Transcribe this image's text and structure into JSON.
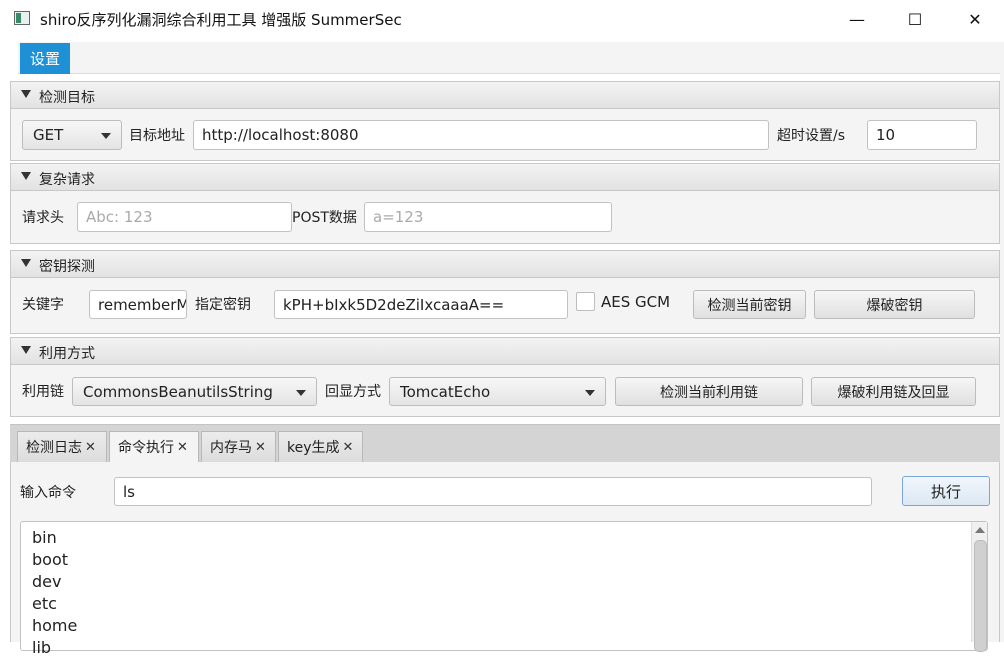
{
  "window": {
    "title": "shiro反序列化漏洞综合利用工具 增强版 SummerSec",
    "minimize": "—",
    "maximize": "☐",
    "close": "✕"
  },
  "menu": {
    "settings": "设置"
  },
  "target": {
    "header": "检测目标",
    "method": "GET",
    "url_label": "目标地址",
    "url_value": "http://localhost:8080",
    "timeout_label": "超时设置/s",
    "timeout_value": "10"
  },
  "complex": {
    "header": "复杂请求",
    "headers_label": "请求头",
    "headers_placeholder": "Abc: 123",
    "post_label": "POST数据",
    "post_placeholder": "a=123"
  },
  "key": {
    "header": "密钥探测",
    "keyword_label": "关键字",
    "keyword_value": "rememberMe",
    "specify_label": "指定密钥",
    "key_value": "kPH+bIxk5D2deZiIxcaaaA==",
    "aes_gcm_label": "AES GCM",
    "check_button": "检测当前密钥",
    "brute_button": "爆破密钥"
  },
  "exploit": {
    "header": "利用方式",
    "chain_label": "利用链",
    "chain_value": "CommonsBeanutilsString",
    "echo_label": "回显方式",
    "echo_value": "TomcatEcho",
    "check_button": "检测当前利用链",
    "brute_button": "爆破利用链及回显"
  },
  "tabs": [
    {
      "label": "检测日志",
      "close": "✕"
    },
    {
      "label": "命令执行",
      "close": "✕"
    },
    {
      "label": "内存马",
      "close": "✕"
    },
    {
      "label": "key生成",
      "close": "✕"
    }
  ],
  "command": {
    "input_label": "输入命令",
    "input_value": "ls",
    "execute_button": "执行",
    "output_lines": [
      "bin",
      "boot",
      "dev",
      "etc",
      "home",
      "lib"
    ]
  }
}
